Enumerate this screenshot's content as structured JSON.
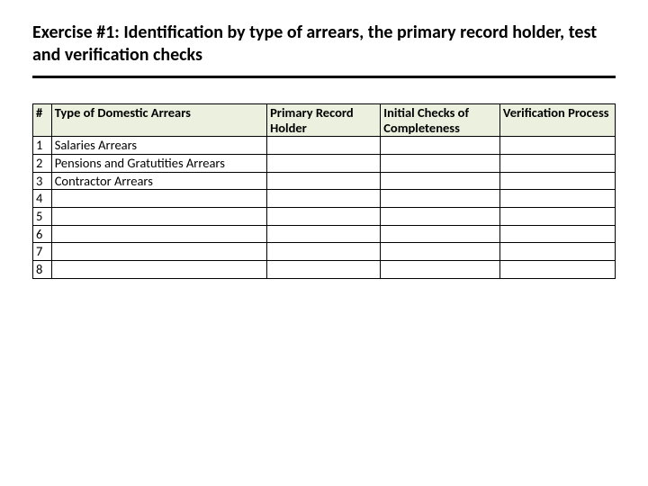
{
  "title": "Exercise #1: Identification by type of arrears, the primary record holder, test and verification checks",
  "headers": {
    "num": "#",
    "type": "Type of Domestic Arrears",
    "primary": "Primary Record Holder",
    "initial": "Initial Checks of Completeness",
    "verification": "Verification Process"
  },
  "rows": [
    {
      "num": "1",
      "type": "Salaries Arrears",
      "primary": "",
      "initial": "",
      "verification": ""
    },
    {
      "num": "2",
      "type": "Pensions and Gratutities Arrears",
      "primary": "",
      "initial": "",
      "verification": ""
    },
    {
      "num": "3",
      "type": "Contractor Arrears",
      "primary": "",
      "initial": "",
      "verification": ""
    },
    {
      "num": "4",
      "type": "",
      "primary": "",
      "initial": "",
      "verification": ""
    },
    {
      "num": "5",
      "type": "",
      "primary": "",
      "initial": "",
      "verification": ""
    },
    {
      "num": "6",
      "type": "",
      "primary": "",
      "initial": "",
      "verification": ""
    },
    {
      "num": "7",
      "type": "",
      "primary": "",
      "initial": "",
      "verification": ""
    },
    {
      "num": "8",
      "type": "",
      "primary": "",
      "initial": "",
      "verification": ""
    }
  ]
}
